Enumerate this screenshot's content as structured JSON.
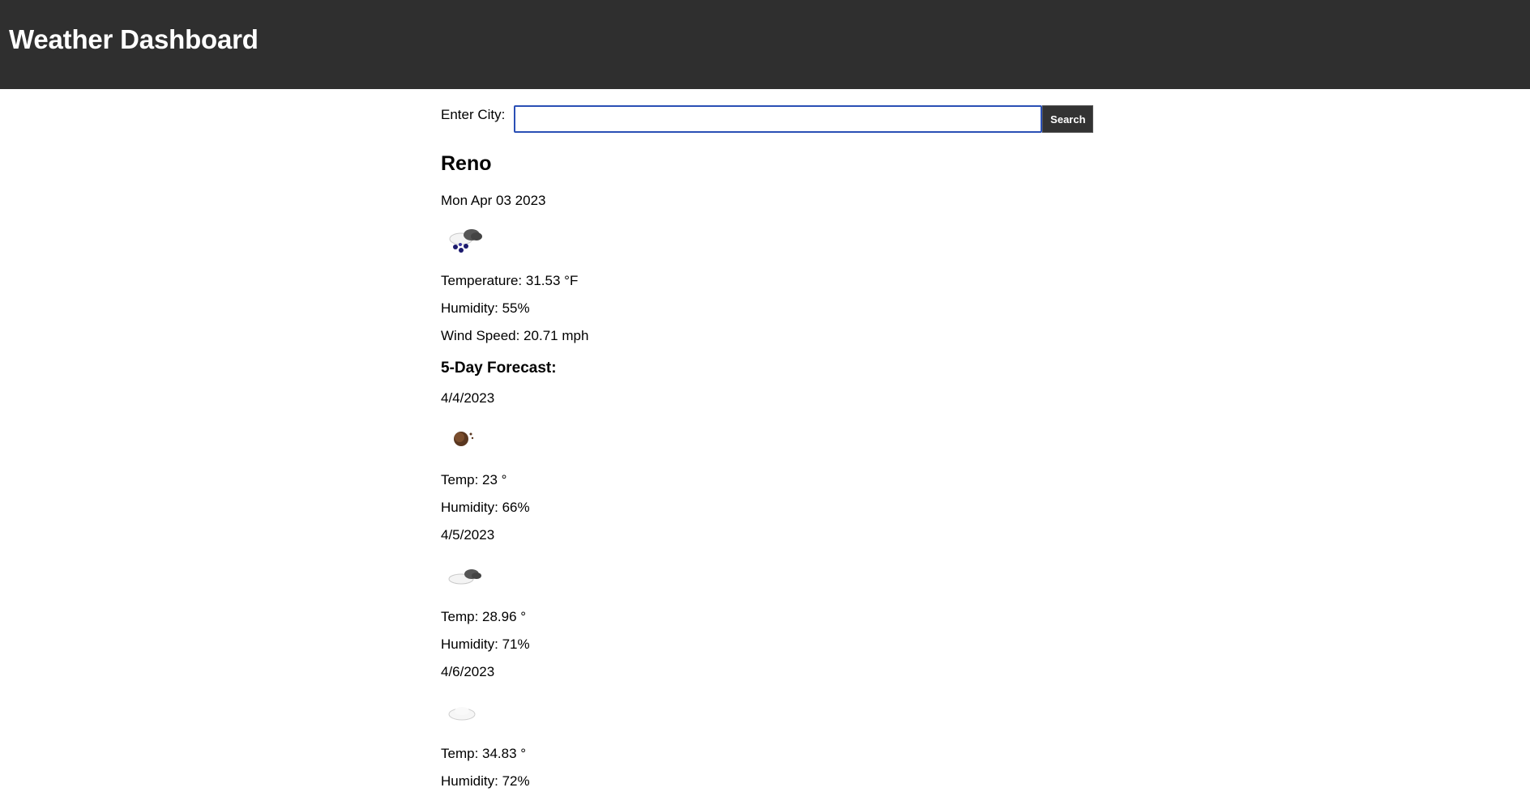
{
  "header": {
    "title": "Weather Dashboard"
  },
  "search": {
    "label": "Enter City:",
    "value": "",
    "placeholder": "",
    "button_label": "Search"
  },
  "current": {
    "city": "Reno",
    "date": "Mon Apr 03 2023",
    "icon": "rain-snow-cloud-icon",
    "temperature": "Temperature: 31.53 °F",
    "humidity": "Humidity: 55%",
    "wind": "Wind Speed: 20.71 mph"
  },
  "forecast": {
    "title": "5-Day Forecast:",
    "days": [
      {
        "date": "4/4/2023",
        "icon": "night-moon-icon",
        "temp": "Temp: 23 °",
        "humidity": "Humidity: 66%"
      },
      {
        "date": "4/5/2023",
        "icon": "cloudy-icon",
        "temp": "Temp: 28.96 °",
        "humidity": "Humidity: 71%"
      },
      {
        "date": "4/6/2023",
        "icon": "cloud-icon",
        "temp": "Temp: 34.83 °",
        "humidity": "Humidity: 72%"
      }
    ]
  },
  "colors": {
    "header_bg": "#2f2f2f",
    "input_border": "#2a4fb5",
    "button_bg": "#333333"
  }
}
